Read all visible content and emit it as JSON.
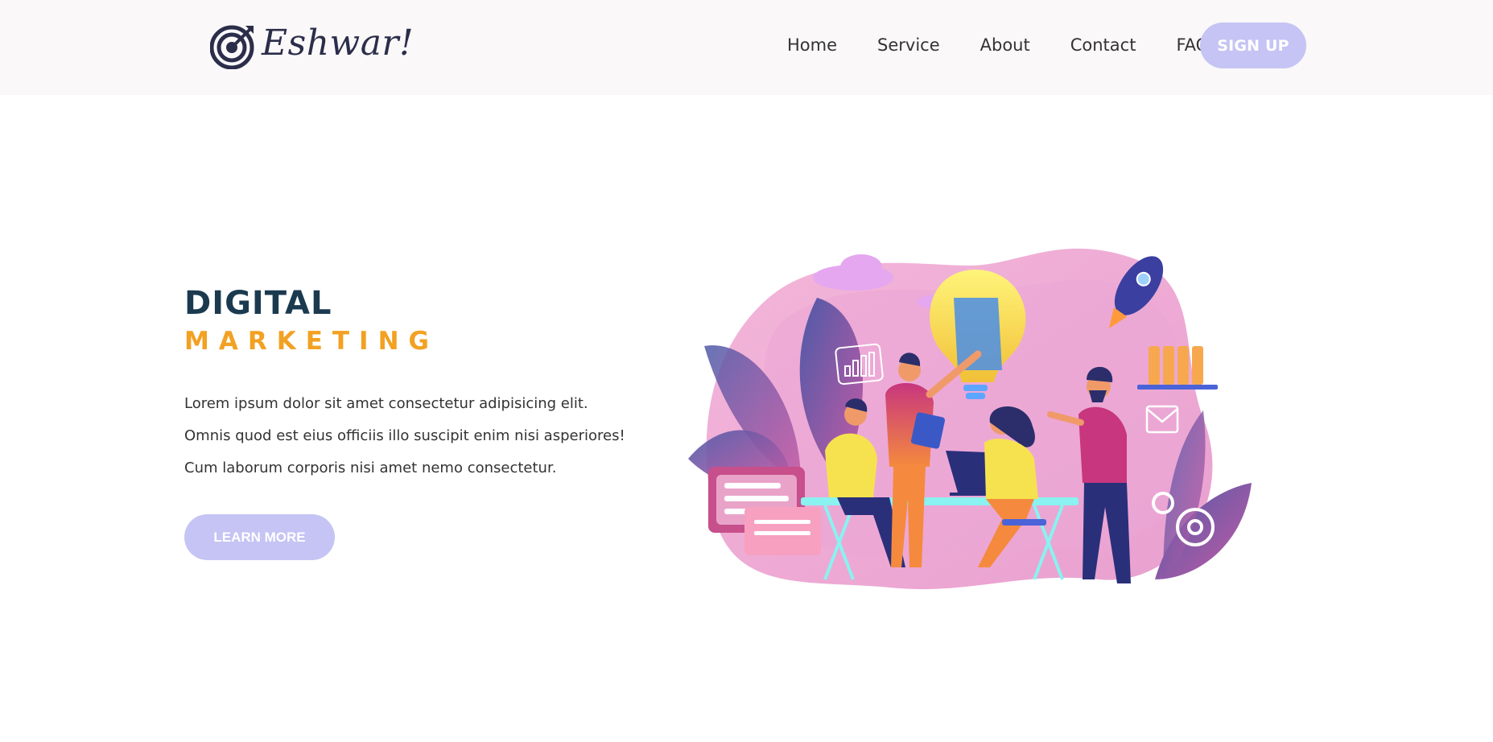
{
  "brand": {
    "name": "Eshwar!"
  },
  "nav": {
    "items": [
      {
        "label": "Home"
      },
      {
        "label": "Service"
      },
      {
        "label": "About"
      },
      {
        "label": "Contact"
      },
      {
        "label": "FAQ"
      }
    ],
    "signup_label": "SIGN UP"
  },
  "hero": {
    "title": "DIGITAL",
    "subtitle": "MARKETING",
    "description": "Lorem ipsum dolor sit amet consectetur adipisicing elit. Omnis quod est eius officiis illo suscipit enim nisi asperiores! Cum laborum corporis nisi amet nemo consectetur.",
    "cta_label": "LEARN MORE"
  },
  "colors": {
    "accent": "#c5c4f4",
    "title": "#1b3a4f",
    "subtitle": "#f2a122",
    "navbar_bg": "#faf8f9"
  },
  "icons": {
    "logo": "target-icon"
  }
}
